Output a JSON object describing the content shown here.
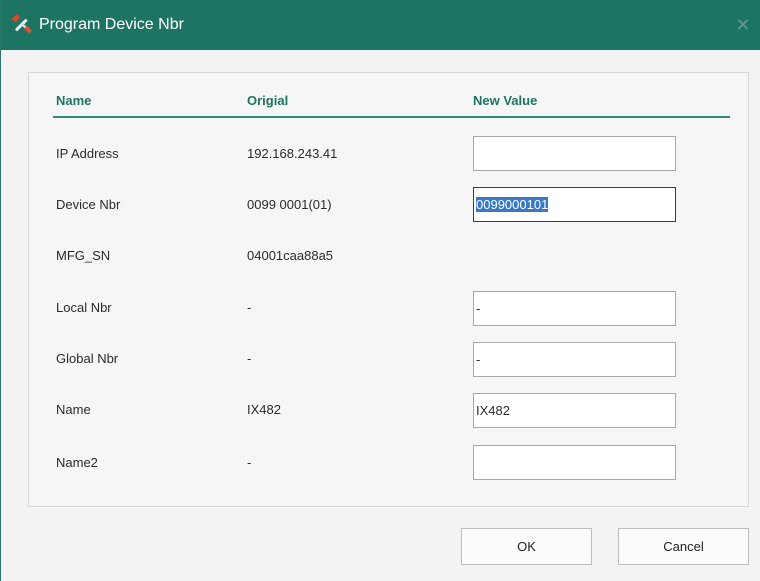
{
  "window": {
    "title": "Program Device Nbr",
    "title_icon": "tools-icon",
    "close_icon": "close-icon",
    "accent_color": "#1e7463"
  },
  "table": {
    "headers": {
      "name": "Name",
      "original": "Origial",
      "new_value": "New Value"
    },
    "rows": [
      {
        "label": "IP Address",
        "original": "192.168.243.41",
        "new_value": "",
        "has_field": true
      },
      {
        "label": "Device Nbr",
        "original": "0099 0001(01)",
        "new_value": "0099000101",
        "has_field": true,
        "selected": true
      },
      {
        "label": "MFG_SN",
        "original": "04001caa88a5",
        "has_field": false
      },
      {
        "label": "Local Nbr",
        "original": "-",
        "new_value": "-",
        "has_field": true
      },
      {
        "label": "Global Nbr",
        "original": "-",
        "new_value": "-",
        "has_field": true
      },
      {
        "label": "Name",
        "original": "IX482",
        "new_value": "IX482",
        "has_field": true
      },
      {
        "label": "Name2",
        "original": "-",
        "new_value": "",
        "has_field": true
      }
    ]
  },
  "buttons": {
    "ok": "OK",
    "cancel": "Cancel"
  }
}
